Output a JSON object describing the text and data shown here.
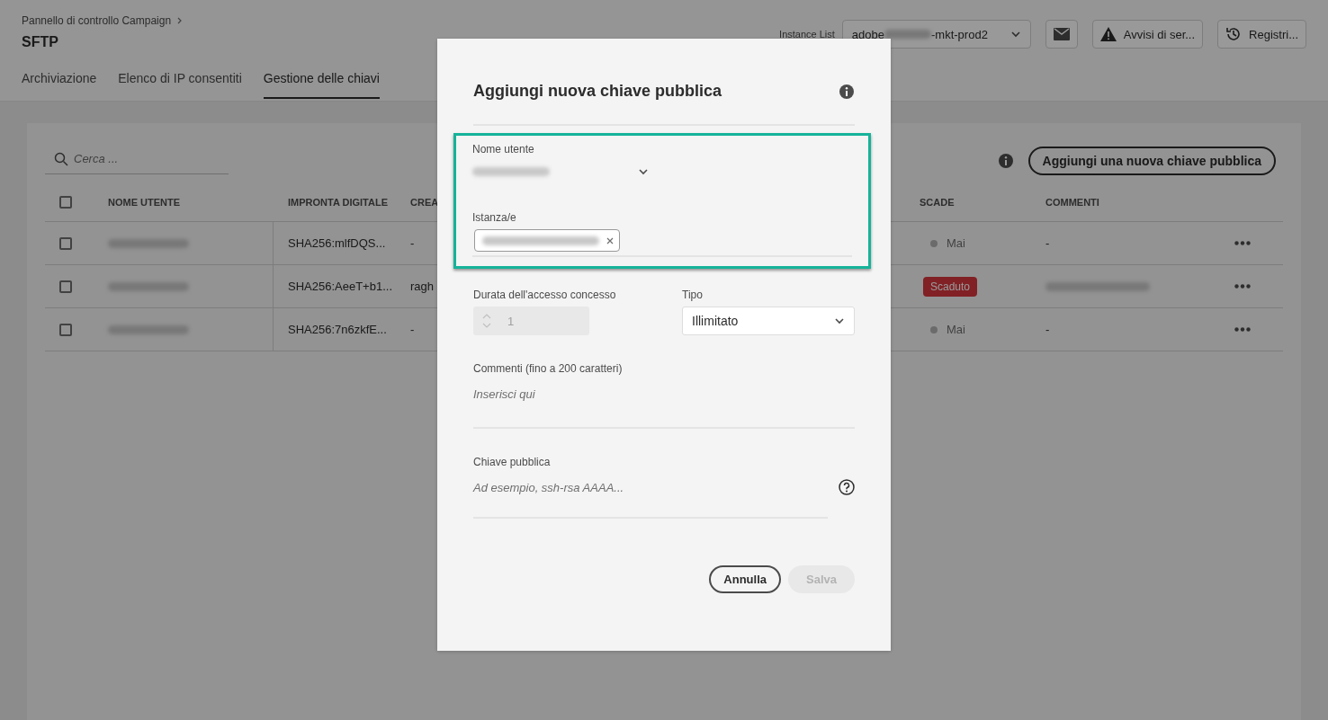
{
  "header": {
    "breadcrumb": "Pannello di controllo Campaign",
    "title": "SFTP",
    "tabs": [
      {
        "label": "Archiviazione",
        "selected": false
      },
      {
        "label": "Elenco di IP consentiti",
        "selected": false
      },
      {
        "label": "Gestione delle chiavi",
        "selected": true
      }
    ],
    "instance_label": "Instance List",
    "instance_prefix": "adobe",
    "instance_suffix": "-mkt-prod2",
    "alerts_button": "Avvisi di ser...",
    "logs_button": "Registri..."
  },
  "toolbar": {
    "search_placeholder": "Cerca ...",
    "add_button": "Aggiungi una nuova chiave pubblica"
  },
  "table": {
    "select_all_checked": false,
    "columns": [
      "NOME UTENTE",
      "IMPRONTA DIGITALE",
      "CREA",
      "SCADE",
      "COMMENTI"
    ],
    "rows": [
      {
        "checked": false,
        "fingerprint": "SHA256:mlfDQS...",
        "created": "-",
        "expires": {
          "kind": "dot",
          "text": "Mai"
        },
        "comment": "-",
        "comment_blurred": false
      },
      {
        "checked": false,
        "fingerprint": "SHA256:AeeT+b1...",
        "created": "ragh",
        "expires": {
          "kind": "badge",
          "text": "Scaduto"
        },
        "comment_blurred": true
      },
      {
        "checked": false,
        "fingerprint": "SHA256:7n6zkfE...",
        "created": "-",
        "expires": {
          "kind": "dot",
          "text": "Mai"
        },
        "comment": "-",
        "comment_blurred": false
      }
    ]
  },
  "dialog": {
    "title": "Aggiungi nuova chiave pubblica",
    "username_label": "Nome utente",
    "instances_label": "Istanza/e",
    "duration_label": "Durata dell'accesso concesso",
    "duration_value": "1",
    "duration_disabled": true,
    "type_label": "Tipo",
    "type_value": "Illimitato",
    "comments_label": "Commenti (fino a 200 caratteri)",
    "comments_placeholder": "Inserisci qui",
    "key_label": "Chiave pubblica",
    "key_placeholder": "Ad esempio, ssh-rsa AAAA...",
    "cancel_button": "Annulla",
    "save_button": "Salva",
    "save_disabled": true
  }
}
